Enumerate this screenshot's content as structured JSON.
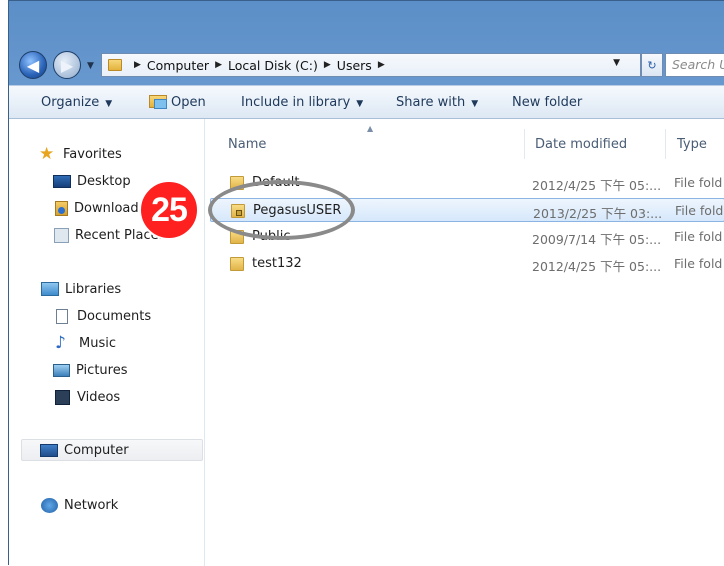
{
  "address": {
    "crumbs": [
      "Computer",
      "Local Disk (C:)",
      "Users"
    ],
    "search_placeholder": "Search Us"
  },
  "toolbar": {
    "organize": "Organize",
    "open": "Open",
    "include": "Include in library",
    "share": "Share with",
    "newfolder": "New folder"
  },
  "nav": {
    "favorites": "Favorites",
    "desktop": "Desktop",
    "downloads": "Downloads",
    "recent": "Recent Places",
    "libraries": "Libraries",
    "documents": "Documents",
    "music": "Music",
    "pictures": "Pictures",
    "videos": "Videos",
    "computer": "Computer",
    "network": "Network"
  },
  "columns": {
    "name": "Name",
    "date": "Date modified",
    "type": "Type"
  },
  "files": [
    {
      "name": "Default",
      "date": "2012/4/25 下午 05:...",
      "type": "File fold"
    },
    {
      "name": "PegasusUSER",
      "date": "2013/2/25 下午 03:...",
      "type": "File fold"
    },
    {
      "name": "Public",
      "date": "2009/7/14 下午 05:...",
      "type": "File fold"
    },
    {
      "name": "test132",
      "date": "2012/4/25 下午 05:...",
      "type": "File fold"
    }
  ],
  "annotation": {
    "step_number": "25"
  }
}
